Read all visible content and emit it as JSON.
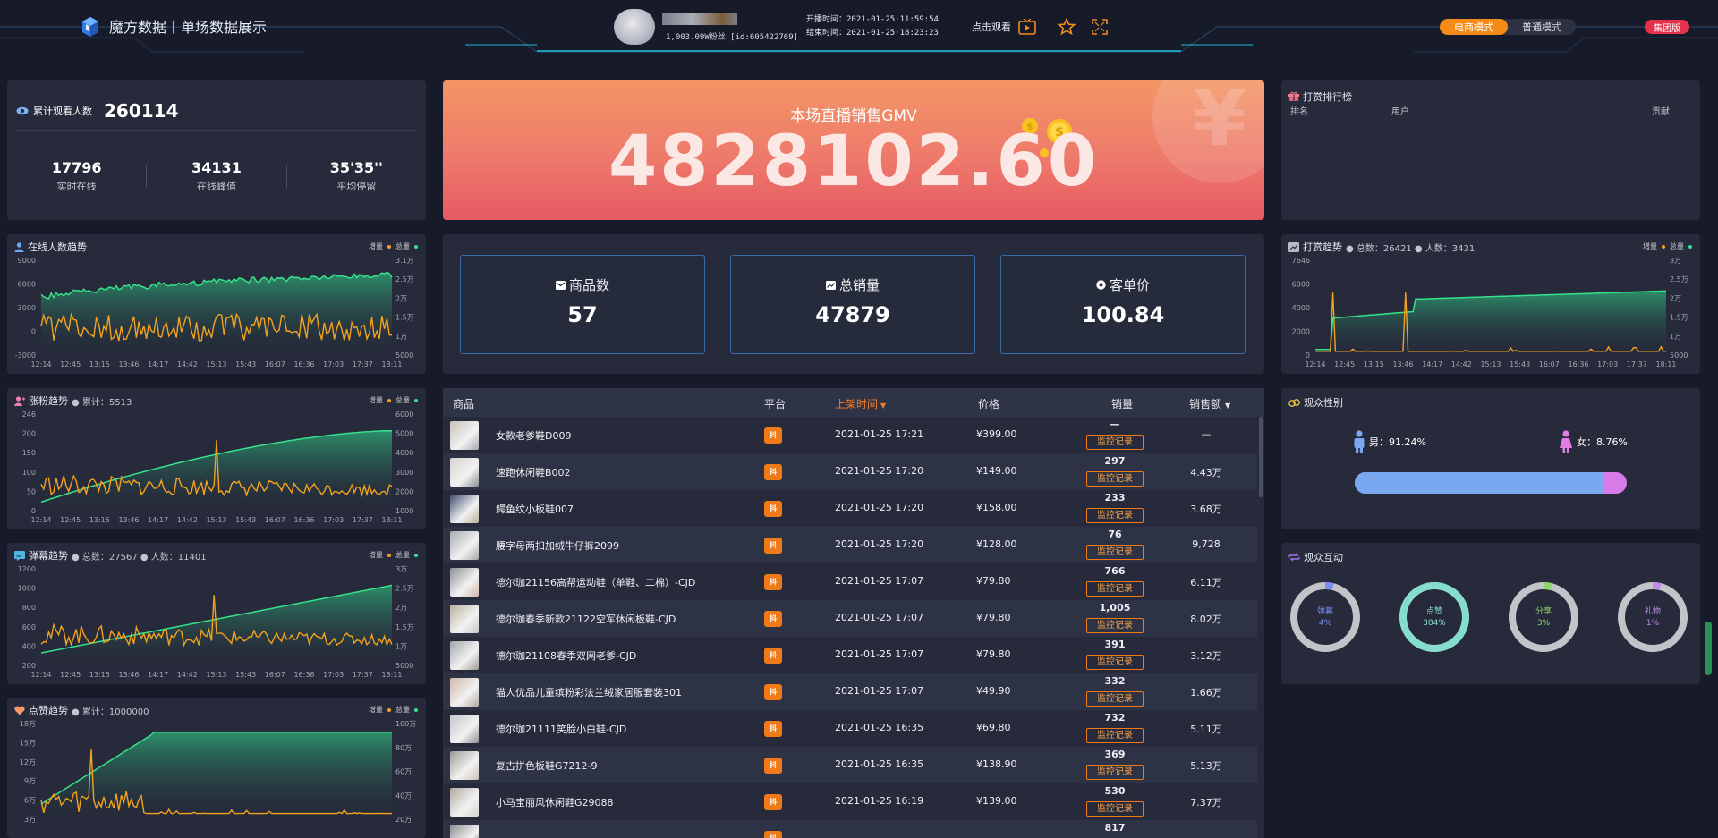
{
  "header": {
    "app_title": "魔方数据丨单场数据展示",
    "fans": "1,003.09W粉丝 [id:605422769]",
    "start_time": "开播时间：2021-01-25·11:59:54",
    "end_time": "结束时间：2021-01-25·18:23:23",
    "watch_label": "点击观看",
    "modes": [
      "电商模式",
      "普通模式"
    ],
    "group_label": "集团版"
  },
  "viewers": {
    "label": "累计观看人数",
    "total": "260114",
    "stats": [
      {
        "value": "17796",
        "label": "实时在线"
      },
      {
        "value": "34131",
        "label": "在线峰值"
      },
      {
        "value": "35'35''",
        "label": "平均停留"
      }
    ]
  },
  "gmv": {
    "label": "本场直播销售GMV",
    "value": "4828102.60"
  },
  "cards": [
    {
      "label": "商品数",
      "value": "57"
    },
    {
      "label": "总销量",
      "value": "47879"
    },
    {
      "label": "客单价",
      "value": "100.84"
    }
  ],
  "legend": {
    "inc": "增量",
    "total": "总量"
  },
  "charts": {
    "online": {
      "title": "在线人数趋势",
      "y_left": [
        "9000",
        "6000",
        "3000",
        "0",
        "-3000"
      ],
      "y_right": [
        "3.1万",
        "2.5万",
        "2万",
        "1.5万",
        "1万",
        "5000"
      ],
      "x": [
        "12:14",
        "12:45",
        "13:15",
        "13:46",
        "14:17",
        "14:42",
        "15:13",
        "15:43",
        "16:07",
        "16:36",
        "17:03",
        "17:37",
        "18:11"
      ]
    },
    "fans": {
      "title": "涨粉趋势",
      "sub": "● 累计：5513",
      "y_left": [
        "246",
        "200",
        "150",
        "100",
        "50",
        "0"
      ],
      "y_right": [
        "6000",
        "5000",
        "4000",
        "3000",
        "2000",
        "1000"
      ],
      "x": [
        "12:14",
        "12:45",
        "13:15",
        "13:46",
        "14:17",
        "14:42",
        "15:13",
        "15:43",
        "16:07",
        "16:36",
        "17:03",
        "17:37",
        "18:11"
      ]
    },
    "danmu": {
      "title": "弹幕趋势",
      "sub": "● 总数：27567 ● 人数：11401",
      "y_left": [
        "1200",
        "1000",
        "800",
        "600",
        "400",
        "200"
      ],
      "y_right": [
        "3万",
        "2.5万",
        "2万",
        "1.5万",
        "1万",
        "5000"
      ],
      "x": [
        "12:14",
        "12:45",
        "13:15",
        "13:46",
        "14:17",
        "14:42",
        "15:13",
        "15:43",
        "16:07",
        "16:36",
        "17:03",
        "17:37",
        "18:11"
      ]
    },
    "likes": {
      "title": "点赞趋势",
      "sub": "● 累计：1000000",
      "y_left": [
        "18万",
        "15万",
        "12万",
        "9万",
        "6万",
        "3万"
      ],
      "y_right": [
        "100万",
        "80万",
        "60万",
        "40万",
        "20万"
      ]
    },
    "reward": {
      "title": "打赏趋势",
      "sub": "● 总数：26421 ● 人数：3431",
      "y_left": [
        "7646",
        "6000",
        "4000",
        "2000",
        "0"
      ],
      "y_right": [
        "3万",
        "2.5万",
        "2万",
        "1.5万",
        "1万",
        "5000"
      ],
      "x": [
        "12:14",
        "12:45",
        "13:15",
        "13:46",
        "14:17",
        "14:42",
        "15:13",
        "15:43",
        "16:07",
        "16:36",
        "17:03",
        "17:37",
        "18:11"
      ]
    }
  },
  "rank": {
    "title": "打赏排行榜",
    "cols": [
      "排名",
      "用户",
      "贡献"
    ]
  },
  "gender": {
    "title": "观众性别",
    "male": "男：91.24%",
    "female": "女：8.76%",
    "male_fraction": 0.9124
  },
  "interact": {
    "title": "观众互动",
    "items": [
      {
        "name": "弹幕",
        "pct": "4%",
        "color": "#7b8cf5",
        "fraction": 0.04
      },
      {
        "name": "点赞",
        "pct": "384%",
        "color": "#86dccd",
        "fraction": 1
      },
      {
        "name": "分享",
        "pct": "3%",
        "color": "#8fd46a",
        "fraction": 0.03
      },
      {
        "name": "礼物",
        "pct": "1%",
        "color": "#c08ce6",
        "fraction": 0.01
      }
    ]
  },
  "table": {
    "cols": {
      "product": "商品",
      "platform": "平台",
      "time": "上架时间",
      "price": "价格",
      "sales": "销量",
      "revenue": "销售额"
    },
    "monitor": "监控记录",
    "rows": [
      {
        "name": "女款老爹鞋D009",
        "time": "2021-01-25 17:21",
        "price": "¥399.00",
        "sales": "—",
        "revenue": "—"
      },
      {
        "name": "速跑休闲鞋B002",
        "time": "2021-01-25 17:20",
        "price": "¥149.00",
        "sales": "297",
        "revenue": "4.43万"
      },
      {
        "name": "鳄鱼纹小板鞋007",
        "time": "2021-01-25 17:20",
        "price": "¥158.00",
        "sales": "233",
        "revenue": "3.68万"
      },
      {
        "name": "腰字母两扣加绒牛仔裤2099",
        "time": "2021-01-25 17:20",
        "price": "¥128.00",
        "sales": "76",
        "revenue": "9,728"
      },
      {
        "name": "德尔珈21156高帮运动鞋（单鞋、二棉）-CJD",
        "time": "2021-01-25 17:07",
        "price": "¥79.80",
        "sales": "766",
        "revenue": "6.11万"
      },
      {
        "name": "德尔珈春季新款21122空军休闲板鞋-CJD",
        "time": "2021-01-25 17:07",
        "price": "¥79.80",
        "sales": "1,005",
        "revenue": "8.02万"
      },
      {
        "name": "德尔珈21108春季双网老爹-CJD",
        "time": "2021-01-25 17:07",
        "price": "¥79.80",
        "sales": "391",
        "revenue": "3.12万"
      },
      {
        "name": "猫人优品儿童缤粉彩法兰绒家居服套装301",
        "time": "2021-01-25 17:07",
        "price": "¥49.90",
        "sales": "332",
        "revenue": "1.66万"
      },
      {
        "name": "德尔珈21111笑脸小白鞋-CJD",
        "time": "2021-01-25 16:35",
        "price": "¥69.80",
        "sales": "732",
        "revenue": "5.11万"
      },
      {
        "name": "复古拼色板鞋G7212-9",
        "time": "2021-01-25 16:35",
        "price": "¥138.90",
        "sales": "369",
        "revenue": "5.13万"
      },
      {
        "name": "小马宝丽风休闲鞋G29088",
        "time": "2021-01-25 16:19",
        "price": "¥139.00",
        "sales": "530",
        "revenue": "7.37万"
      },
      {
        "name": "",
        "time": "",
        "price": "",
        "sales": "817",
        "revenue": ""
      }
    ]
  }
}
